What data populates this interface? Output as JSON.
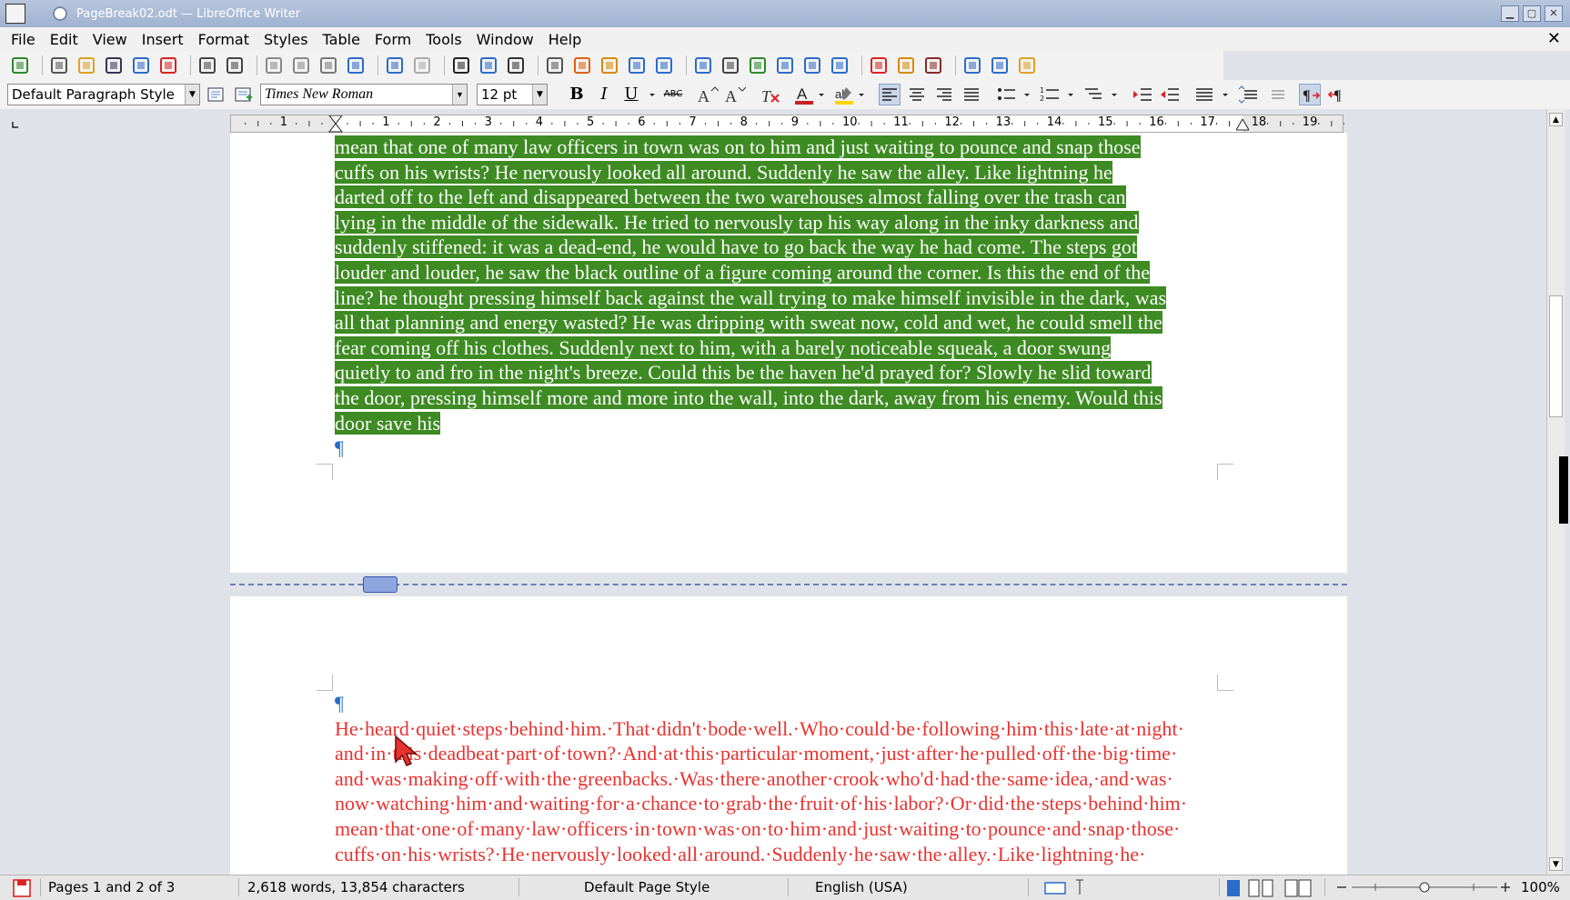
{
  "window": {
    "title": "PageBreak02.odt — LibreOffice Writer",
    "controls": [
      "minimize",
      "maximize",
      "close"
    ]
  },
  "menubar": {
    "items": [
      "File",
      "Edit",
      "View",
      "Insert",
      "Format",
      "Styles",
      "Table",
      "Form",
      "Tools",
      "Window",
      "Help"
    ]
  },
  "toolbar_standard": {
    "icons": [
      "find-icon",
      "new-document-icon",
      "open-icon",
      "save-icon",
      "save-as-icon",
      "export-pdf-icon",
      "print-icon",
      "print-preview-icon",
      "cut-icon",
      "copy-icon",
      "paste-icon",
      "clone-formatting-icon",
      "undo-icon",
      "redo-icon",
      "find-replace-icon",
      "spelling-icon",
      "formatting-marks-icon",
      "insert-table-icon",
      "insert-image-icon",
      "insert-chart-icon",
      "insert-textbox-icon",
      "insert-page-break-icon",
      "insert-field-icon",
      "insert-special-char-icon",
      "insert-hyperlink-icon",
      "insert-footnote-icon",
      "insert-endnote-icon",
      "insert-bookmark-icon",
      "insert-cross-reference-icon",
      "insert-comment-icon",
      "track-changes-icon",
      "insert-line-icon",
      "basic-shapes-icon",
      "show-draw-functions-icon"
    ]
  },
  "toolbar_formatting": {
    "paragraph_style": "Default Paragraph Style",
    "font_name": "Times New Roman",
    "font_size": "12 pt",
    "bold_label": "B",
    "italic_label": "I",
    "underline_label": "U",
    "strikethrough_label": "ABC"
  },
  "ruler": {
    "ticks": [
      "1",
      "1",
      "2",
      "3",
      "4",
      "5",
      "6",
      "7",
      "8",
      "9",
      "10",
      "11",
      "12",
      "13",
      "14",
      "15",
      "16",
      "17",
      "18",
      "19"
    ]
  },
  "document": {
    "page1_lines": [
      "mean that one of many law officers in town was on to him and just waiting to pounce and snap those",
      "cuffs on his wrists? He nervously looked all around. Suddenly he saw the alley. Like lightning he",
      "darted off to the left and disappeared between the two warehouses almost falling over the trash can",
      "lying in the middle of the sidewalk. He tried to nervously tap his way along in the inky darkness and",
      "suddenly stiffened: it was a dead-end, he would have to go back the way he had come. The steps got",
      "louder and louder, he saw the black outline of a figure coming around the corner. Is this the end of the",
      "line? he thought pressing himself back against the wall trying to make himself invisible in the dark, was",
      "all that planning and energy wasted? He was dripping with sweat now, cold and wet, he could smell the",
      "fear coming off his clothes. Suddenly next to him, with a barely noticeable squeak, a door swung",
      "quietly to and fro in the night's breeze. Could this be the haven he'd prayed for? Slowly he slid toward",
      "the door, pressing himself more and more into the wall, into the dark, away from his enemy. Would this",
      "door save his"
    ],
    "pilcrow": "¶",
    "page2_lines": [
      "He·heard·quiet·steps·behind·him.·That·didn't·bode·well.·Who·could·be·following·him·this·late·at·night·",
      "and·in·this·deadbeat·part·of·town?·And·at·this·particular·moment,·just·after·he·pulled·off·the·big·time·",
      "and·was·making·off·with·the·greenbacks.·Was·there·another·crook·who'd·had·the·same·idea,·and·was·",
      "now·watching·him·and·waiting·for·a·chance·to·grab·the·fruit·of·his·labor?·Or·did·the·steps·behind·him·",
      "mean·that·one·of·many·law·officers·in·town·was·on·to·him·and·just·waiting·to·pounce·and·snap·those·",
      "cuffs·on·his·wrists?·He·nervously·looked·all·around.·Suddenly·he·saw·the·alley.·Like·lightning·he·"
    ],
    "selection_color": "#3d8b22",
    "page2_text_color": "#e8322f"
  },
  "statusbar": {
    "page_info": "Pages 1 and 2 of 3",
    "word_count": "2,618 words, 13,854 characters",
    "page_style": "Default Page Style",
    "language": "English (USA)",
    "zoom": "100%"
  }
}
